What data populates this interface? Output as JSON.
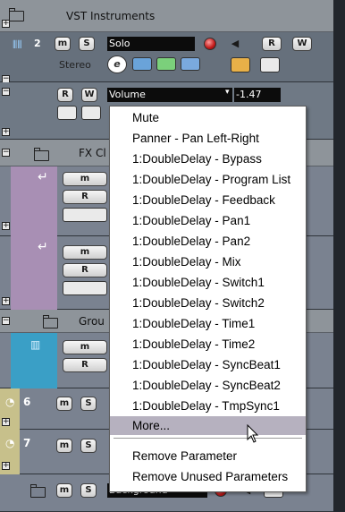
{
  "header": {
    "title": "VST Instruments"
  },
  "track2": {
    "number": "2",
    "name": "Solo",
    "mode": "Stereo"
  },
  "automation": {
    "param_label": "Volume",
    "value": "-1.47"
  },
  "fx_folder": {
    "title": "FX Cl"
  },
  "group_folder": {
    "title": "Grou"
  },
  "track6": {
    "number": "6"
  },
  "track7": {
    "number": "7"
  },
  "bottom_track": {
    "name": "Background"
  },
  "buttons": {
    "mute": "m",
    "solo": "S",
    "read": "R",
    "write": "W",
    "edit": "e"
  },
  "menu": {
    "items": [
      "Mute",
      "Panner - Pan Left-Right",
      "1:DoubleDelay - Bypass",
      "1:DoubleDelay - Program List",
      "1:DoubleDelay - Feedback",
      "1:DoubleDelay - Pan1",
      "1:DoubleDelay - Pan2",
      "1:DoubleDelay - Mix",
      "1:DoubleDelay - Switch1",
      "1:DoubleDelay - Switch2",
      "1:DoubleDelay - Time1",
      "1:DoubleDelay - Time2",
      "1:DoubleDelay - SyncBeat1",
      "1:DoubleDelay - SyncBeat2",
      "1:DoubleDelay - TmpSync1"
    ],
    "more": "More...",
    "remove_parameter": "Remove Parameter",
    "remove_unused": "Remove Unused Parameters"
  }
}
